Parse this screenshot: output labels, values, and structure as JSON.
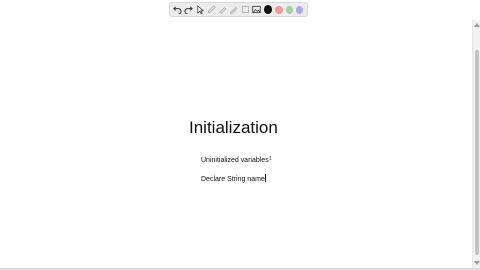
{
  "toolbar": {
    "tools": [
      {
        "name": "undo-icon",
        "enabled": true
      },
      {
        "name": "redo-icon",
        "enabled": true
      },
      {
        "name": "select-icon",
        "enabled": true
      },
      {
        "name": "pen-icon",
        "enabled": false
      },
      {
        "name": "highlighter-icon",
        "enabled": false
      },
      {
        "name": "marker-icon",
        "enabled": false
      },
      {
        "name": "shape-icon",
        "enabled": false
      },
      {
        "name": "image-icon",
        "enabled": true
      }
    ],
    "colors": [
      "#111111",
      "#f29a9a",
      "#9ed39e",
      "#a9a9f0"
    ],
    "selected_color": "#111111"
  },
  "document": {
    "title": "Initialization",
    "lines": [
      "Uninitialized variables",
      "Declare String name"
    ],
    "marker": "1"
  }
}
